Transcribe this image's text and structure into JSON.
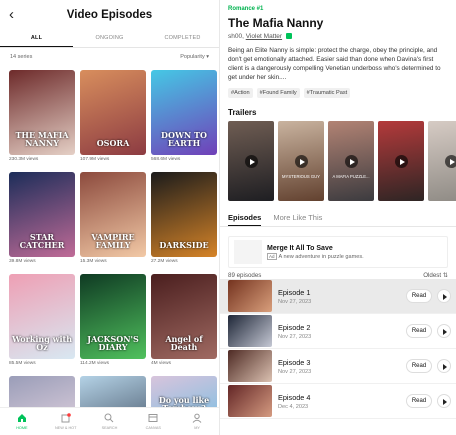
{
  "left": {
    "title": "Video Episodes",
    "tabs": [
      "ALL",
      "ONGOING",
      "COMPLETED"
    ],
    "filter": {
      "count": "14 series",
      "sort": "Popularity"
    },
    "covers": [
      {
        "title": "THE MAFIA NANNY",
        "views": "230.3M views",
        "colors": [
          "#6d2a2a",
          "#e5d0c6"
        ]
      },
      {
        "title": "OSORA",
        "views": "107.9M views",
        "colors": [
          "#d88e5d",
          "#8c3b42"
        ]
      },
      {
        "title": "DOWN TO EARTH",
        "views": "568.6M views",
        "colors": [
          "#45c8e5",
          "#7040b8"
        ]
      },
      {
        "title": "STAR CATCHER",
        "views": "39.8M views",
        "colors": [
          "#1c2d59",
          "#c06b97"
        ]
      },
      {
        "title": "VAMPIRE FAMILY",
        "views": "15.3M views",
        "colors": [
          "#8c4a3d",
          "#f2c9a6"
        ]
      },
      {
        "title": "DARKSIDE",
        "views": "27.2M views",
        "colors": [
          "#1b1b1b",
          "#d68428"
        ]
      },
      {
        "title": "Working with Oz",
        "views": "85.5M views",
        "colors": [
          "#ee9fb4",
          "#d8e8f2"
        ]
      },
      {
        "title": "JACKSON'S DIARY",
        "views": "114.2M views",
        "colors": [
          "#0f3a23",
          "#50c15d"
        ]
      },
      {
        "title": "Angel of Death",
        "views": "4M views",
        "colors": [
          "#4a1e1e",
          "#a06a62"
        ]
      },
      {
        "title": "",
        "views": "",
        "colors": [
          "#9a9db8",
          "#d5c9d8"
        ]
      },
      {
        "title": "",
        "views": "",
        "colors": [
          "#b4d2e6",
          "#5f7184"
        ]
      },
      {
        "title": "Do you like Tomboys?",
        "views": "",
        "colors": [
          "#d8c4dc",
          "#85bfe1"
        ]
      }
    ]
  },
  "bottom_nav": [
    {
      "label": "HOME",
      "icon": "home-icon"
    },
    {
      "label": "NEW & HOT",
      "icon": "new-hot-icon"
    },
    {
      "label": "SEARCH",
      "icon": "search-icon"
    },
    {
      "label": "CANVAS",
      "icon": "canvas-icon"
    },
    {
      "label": "MY",
      "icon": "user-icon"
    }
  ],
  "right": {
    "genre": "Romance #1",
    "title": "The Mafia Nanny",
    "author1": "sh00,",
    "author2": "Violet Matter",
    "description": "Being an Elite Nanny is simple: protect the charge, obey the principle, and don't get emotionally attached. Easier said than done when Davina's first client is a dangerously compelling Venetian underboss who's determined to get under her skin....",
    "tags": [
      "#Action",
      "#Found Family",
      "#Traumatic Past"
    ],
    "trailers_title": "Trailers",
    "trailers": [
      {
        "caption": "",
        "colors": [
          "#6f5d53",
          "#1e1e22"
        ]
      },
      {
        "caption": "MYSTERIOUS GUY",
        "colors": [
          "#c9b39f",
          "#62412f"
        ]
      },
      {
        "caption": "A MAFIA PUZZLE...",
        "colors": [
          "#b28374",
          "#3c3b3f"
        ]
      },
      {
        "caption": "",
        "colors": [
          "#b43a3b",
          "#2e2524"
        ]
      },
      {
        "caption": "",
        "colors": [
          "#d6cbc4",
          "#8e8a84"
        ]
      }
    ],
    "tabs": [
      "Episodes",
      "More Like This"
    ],
    "ad": {
      "title": "Merge It All To Save",
      "badge": "Ad",
      "subtitle": "A new adventure in puzzle games."
    },
    "episodes_count": "89 episodes",
    "order": "Oldest",
    "episodes": [
      {
        "title": "Episode 1",
        "date": "Nov 27, 2023",
        "read": "Read",
        "colors": [
          "#74331f",
          "#d99f7c"
        ]
      },
      {
        "title": "Episode 2",
        "date": "Nov 27, 2023",
        "read": "Read",
        "colors": [
          "#1e2637",
          "#c5c8d4"
        ]
      },
      {
        "title": "Episode 3",
        "date": "Nov 27, 2023",
        "read": "Read",
        "colors": [
          "#4e2a24",
          "#dbc1b1"
        ]
      },
      {
        "title": "Episode 4",
        "date": "Dec 4, 2023",
        "read": "Read",
        "colors": [
          "#632626",
          "#d59b81"
        ]
      }
    ]
  }
}
